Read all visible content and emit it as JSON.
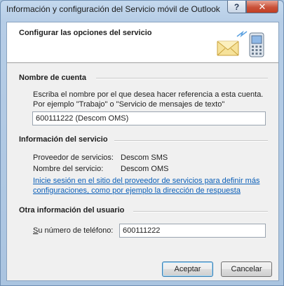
{
  "window": {
    "title": "Información y configuración del Servicio móvil de Outlook",
    "help_glyph": "?",
    "close_glyph": "✕"
  },
  "header": {
    "title": "Configurar las opciones del servicio",
    "icon": "envelope-phone-icon"
  },
  "account": {
    "section_title": "Nombre de cuenta",
    "description_line1": "Escriba el nombre por el que desea hacer referencia a esta cuenta.",
    "description_line2": "Por ejemplo \"Trabajo\" o \"Servicio de mensajes de texto\"",
    "name_value": "600111222 (Descom OMS)"
  },
  "service": {
    "section_title": "Información del servicio",
    "provider_label": "Proveedor de servicios:",
    "provider_value": "Descom SMS",
    "name_label": "Nombre del servicio:",
    "name_value": "Descom OMS",
    "link_line1": "Inicie sesión en el sitio del proveedor de servicios para definir más",
    "link_line2": "configuraciones, como por ejemplo la dirección de respuesta"
  },
  "user": {
    "section_title": "Otra información del usuario",
    "phone_label_accel": "S",
    "phone_label_rest": "u número de teléfono:",
    "phone_value": "600111222"
  },
  "buttons": {
    "accept": "Aceptar",
    "cancel": "Cancelar"
  },
  "colors": {
    "link": "#0b5fb8",
    "close_button": "#c9523a",
    "title_bar": "#b6cde6"
  }
}
